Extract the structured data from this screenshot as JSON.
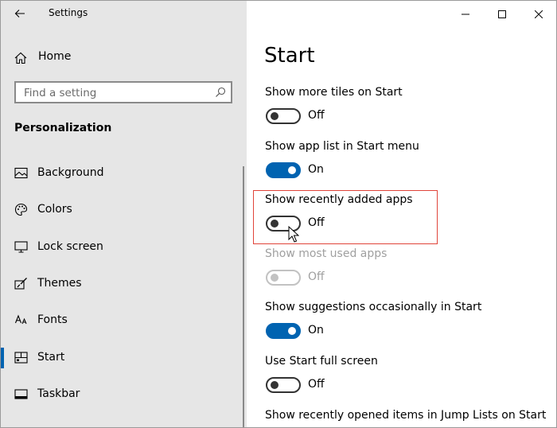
{
  "window": {
    "title": "Settings",
    "controls": {
      "minimize": "minimize-icon",
      "maximize": "maximize-icon",
      "close": "close-icon"
    }
  },
  "sidebar": {
    "home_label": "Home",
    "search_placeholder": "Find a setting",
    "section_title": "Personalization",
    "items": [
      {
        "label": "Background",
        "icon": "picture-icon"
      },
      {
        "label": "Colors",
        "icon": "palette-icon"
      },
      {
        "label": "Lock screen",
        "icon": "monitor-icon"
      },
      {
        "label": "Themes",
        "icon": "brush-icon"
      },
      {
        "label": "Fonts",
        "icon": "font-icon"
      },
      {
        "label": "Start",
        "icon": "start-icon",
        "active": true
      },
      {
        "label": "Taskbar",
        "icon": "taskbar-icon"
      }
    ]
  },
  "main": {
    "title": "Start",
    "settings": [
      {
        "label": "Show more tiles on Start",
        "state": "Off",
        "on": false,
        "enabled": true
      },
      {
        "label": "Show app list in Start menu",
        "state": "On",
        "on": true,
        "enabled": true
      },
      {
        "label": "Show recently added apps",
        "state": "Off",
        "on": false,
        "enabled": true,
        "highlighted": true
      },
      {
        "label": "Show most used apps",
        "state": "Off",
        "on": false,
        "enabled": false
      },
      {
        "label": "Show suggestions occasionally in Start",
        "state": "On",
        "on": true,
        "enabled": true
      },
      {
        "label": "Use Start full screen",
        "state": "Off",
        "on": false,
        "enabled": true
      },
      {
        "label": "Show recently opened items in Jump Lists on Start"
      }
    ]
  },
  "colors": {
    "accent": "#0063b1",
    "highlight": "#e0443a",
    "sidebar_bg": "#e6e6e6"
  }
}
